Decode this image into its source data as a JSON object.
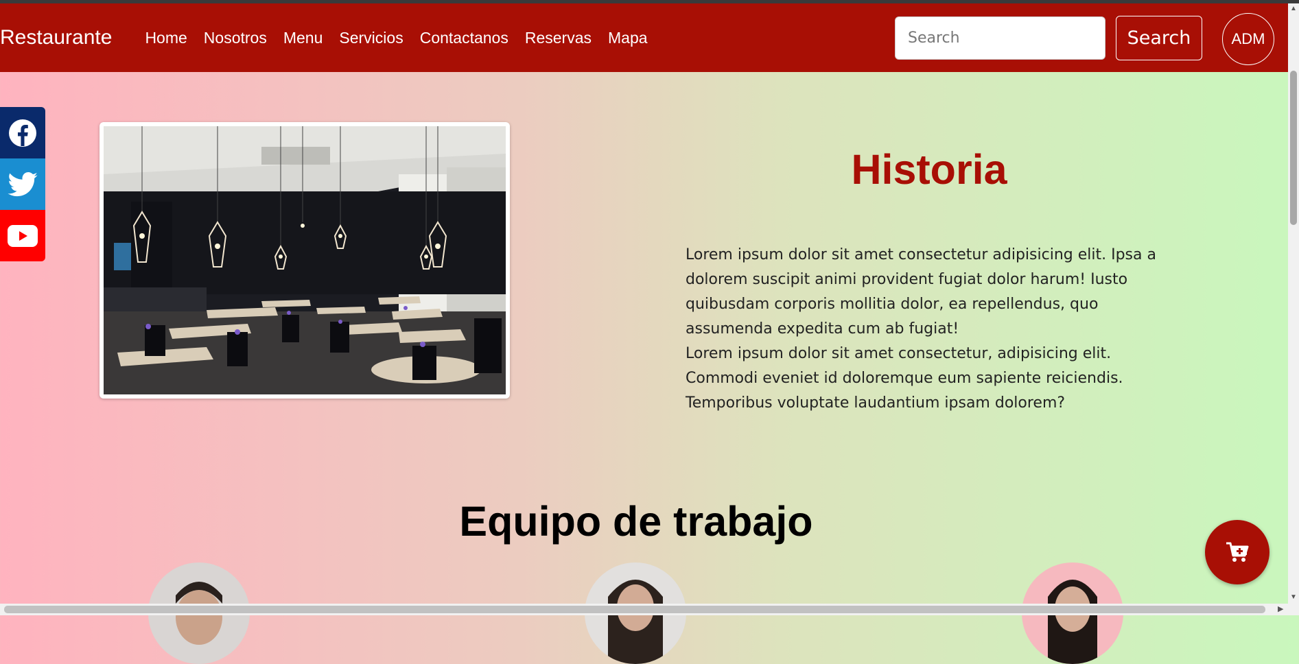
{
  "navbar": {
    "brand": "Restaurante",
    "links": [
      "Home",
      "Nosotros",
      "Menu",
      "Servicios",
      "Contactanos",
      "Reservas",
      "Mapa"
    ],
    "search_placeholder": "Search",
    "search_button": "Search",
    "admin_label": "ADM"
  },
  "social": [
    "facebook-icon",
    "twitter-icon",
    "youtube-icon"
  ],
  "historia": {
    "title": "Historia",
    "paragraphs": [
      "Lorem ipsum dolor sit amet consectetur adipisicing elit. Ipsa a dolorem suscipit animi provident fugiat dolor harum! Iusto quibusdam corporis mollitia dolor, ea repellendus, quo assumenda expedita cum ab fugiat!",
      "Lorem ipsum dolor sit amet consectetur, adipisicing elit. Commodi eveniet id doloremque eum sapiente reiciendis. Temporibus voluptate laudantium ipsam dolorem?"
    ]
  },
  "team": {
    "title": "Equipo de trabajo"
  },
  "colors": {
    "brand_red": "#a80f05",
    "facebook": "#0a2a6b",
    "twitter": "#1a8ed1",
    "youtube": "#ff0000"
  }
}
